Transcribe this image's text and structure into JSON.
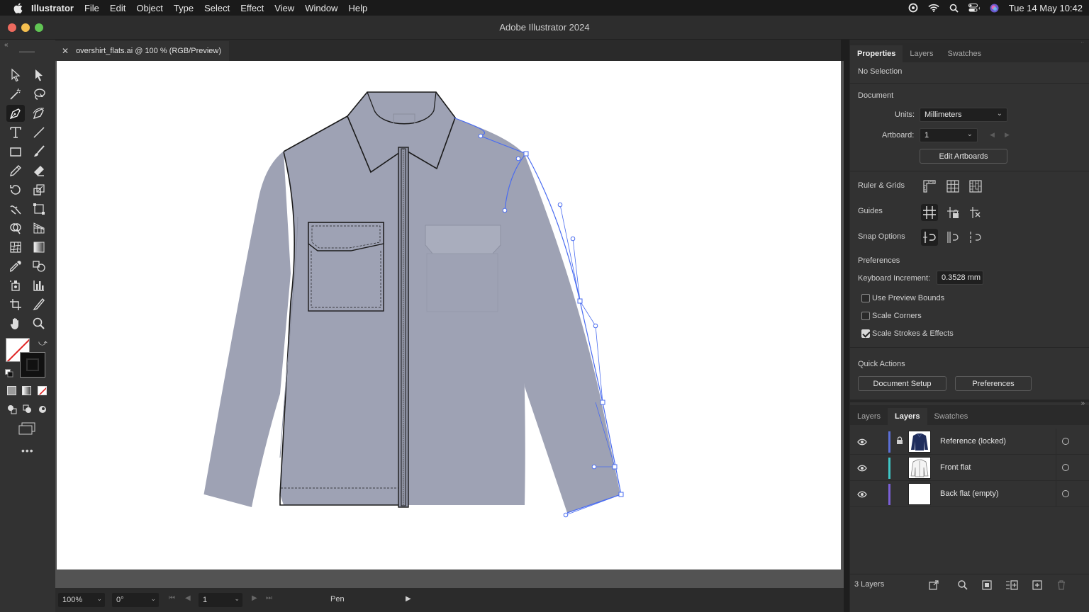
{
  "menubar": {
    "app": "Illustrator",
    "items": [
      "File",
      "Edit",
      "Object",
      "Type",
      "Select",
      "Effect",
      "View",
      "Window",
      "Help"
    ],
    "datetime": "Tue 14 May  10:42"
  },
  "window": {
    "title": "Adobe Illustrator 2024"
  },
  "document_tab": {
    "label": "overshirt_flats.ai @ 100 % (RGB/Preview)"
  },
  "statusbar": {
    "zoom": "100%",
    "rotation": "0°",
    "artboard": "1",
    "tool": "Pen"
  },
  "properties": {
    "tabs": [
      "Properties",
      "Layers",
      "Swatches"
    ],
    "selection": "No Selection",
    "document_heading": "Document",
    "units_label": "Units:",
    "units_value": "Millimeters",
    "artboard_label": "Artboard:",
    "artboard_value": "1",
    "edit_artboards": "Edit Artboards",
    "ruler_grids": "Ruler & Grids",
    "guides": "Guides",
    "snap_options": "Snap Options",
    "preferences_heading": "Preferences",
    "keyboard_increment_label": "Keyboard Increment:",
    "keyboard_increment_value": "0.3528 mm",
    "use_preview_bounds": "Use Preview Bounds",
    "scale_corners": "Scale Corners",
    "scale_strokes": "Scale Strokes & Effects",
    "quick_actions": "Quick Actions",
    "document_setup": "Document Setup",
    "preferences_button": "Preferences"
  },
  "layers_panel": {
    "tabs": [
      "Layers",
      "Layers",
      "Swatches"
    ],
    "layers": [
      {
        "name": "Reference (locked)",
        "color": "#5b6fd6",
        "locked": true
      },
      {
        "name": "Front flat",
        "color": "#3fc6c6",
        "locked": false
      },
      {
        "name": "Back flat (empty)",
        "color": "#7b5fd6",
        "locked": false
      }
    ],
    "count": "3 Layers"
  },
  "colors": {
    "shirt_fill": "#9ea2b4",
    "selection_blue": "#4a6cf0",
    "close": "#ed6a5e",
    "minimize": "#f5bf4f",
    "maximize": "#61c554"
  },
  "toolbar_icons": [
    "selection-tool",
    "direct-selection-tool",
    "magic-wand-tool",
    "lasso-tool",
    "pen-tool",
    "curvature-tool",
    "type-tool",
    "line-tool",
    "rectangle-tool",
    "paintbrush-tool",
    "pencil-tool",
    "eraser-tool",
    "rotate-tool",
    "scale-tool",
    "warp-tool",
    "free-transform-tool",
    "shape-builder-tool",
    "perspective-grid-tool",
    "mesh-tool",
    "gradient-tool",
    "eyedropper-tool",
    "blend-tool",
    "symbol-sprayer-tool",
    "column-graph-tool",
    "artboard-tool",
    "slice-tool",
    "hand-tool",
    "zoom-tool"
  ]
}
